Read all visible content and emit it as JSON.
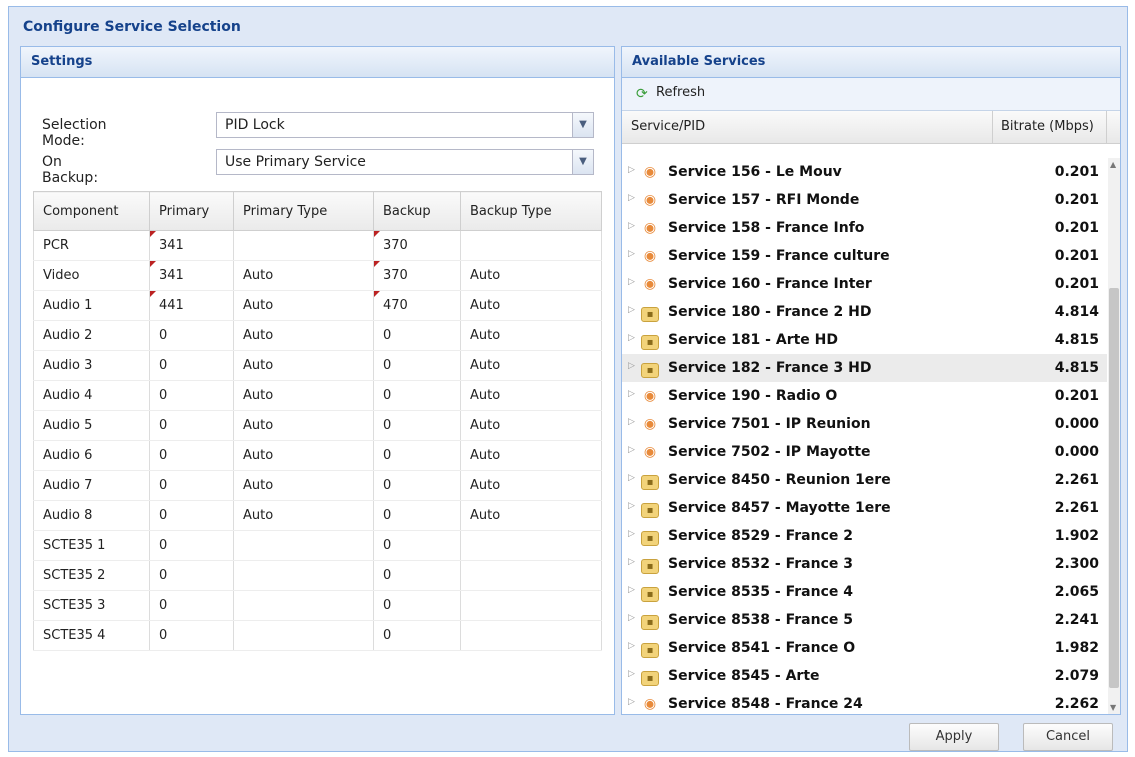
{
  "window": {
    "title": "Configure Service Selection"
  },
  "settings": {
    "title": "Settings",
    "selection_mode": {
      "label": "Selection Mode:",
      "value": "PID Lock"
    },
    "on_backup": {
      "label": "On Backup:",
      "value": "Use Primary Service"
    },
    "table": {
      "headers": [
        "Component",
        "Primary",
        "Primary Type",
        "Backup",
        "Backup Type"
      ],
      "rows": [
        [
          "PCR",
          "341",
          "",
          "370",
          ""
        ],
        [
          "Video",
          "341",
          "Auto",
          "370",
          "Auto"
        ],
        [
          "Audio 1",
          "441",
          "Auto",
          "470",
          "Auto"
        ],
        [
          "Audio 2",
          "0",
          "Auto",
          "0",
          "Auto"
        ],
        [
          "Audio 3",
          "0",
          "Auto",
          "0",
          "Auto"
        ],
        [
          "Audio 4",
          "0",
          "Auto",
          "0",
          "Auto"
        ],
        [
          "Audio 5",
          "0",
          "Auto",
          "0",
          "Auto"
        ],
        [
          "Audio 6",
          "0",
          "Auto",
          "0",
          "Auto"
        ],
        [
          "Audio 7",
          "0",
          "Auto",
          "0",
          "Auto"
        ],
        [
          "Audio 8",
          "0",
          "Auto",
          "0",
          "Auto"
        ],
        [
          "SCTE35 1",
          "0",
          "",
          "0",
          ""
        ],
        [
          "SCTE35 2",
          "0",
          "",
          "0",
          ""
        ],
        [
          "SCTE35 3",
          "0",
          "",
          "0",
          ""
        ],
        [
          "SCTE35 4",
          "0",
          "",
          "0",
          ""
        ]
      ]
    }
  },
  "services": {
    "title": "Available Services",
    "refresh_label": "Refresh",
    "col_service": "Service/PID",
    "col_bitrate": "Bitrate (Mbps)",
    "items": [
      {
        "name": "Service 156 - Le Mouv",
        "bitrate": "0.201",
        "icon": "radio"
      },
      {
        "name": "Service 157 - RFI Monde",
        "bitrate": "0.201",
        "icon": "radio"
      },
      {
        "name": "Service 158 - France Info",
        "bitrate": "0.201",
        "icon": "radio"
      },
      {
        "name": "Service 159 - France culture",
        "bitrate": "0.201",
        "icon": "radio"
      },
      {
        "name": "Service 160 - France Inter",
        "bitrate": "0.201",
        "icon": "radio"
      },
      {
        "name": "Service 180 - France 2 HD",
        "bitrate": "4.814",
        "icon": "lock"
      },
      {
        "name": "Service 181 - Arte HD",
        "bitrate": "4.815",
        "icon": "lock"
      },
      {
        "name": "Service 182 - France 3 HD",
        "bitrate": "4.815",
        "icon": "lock",
        "selected": true
      },
      {
        "name": "Service 190 - Radio O",
        "bitrate": "0.201",
        "icon": "radio"
      },
      {
        "name": "Service 7501 - IP Reunion",
        "bitrate": "0.000",
        "icon": "radio"
      },
      {
        "name": "Service 7502 - IP Mayotte",
        "bitrate": "0.000",
        "icon": "radio"
      },
      {
        "name": "Service 8450 - Reunion 1ere",
        "bitrate": "2.261",
        "icon": "lock"
      },
      {
        "name": "Service 8457 - Mayotte 1ere",
        "bitrate": "2.261",
        "icon": "lock"
      },
      {
        "name": "Service 8529 - France 2",
        "bitrate": "1.902",
        "icon": "lock"
      },
      {
        "name": "Service 8532 - France 3",
        "bitrate": "2.300",
        "icon": "lock"
      },
      {
        "name": "Service 8535 - France 4",
        "bitrate": "2.065",
        "icon": "lock"
      },
      {
        "name": "Service 8538 - France 5",
        "bitrate": "2.241",
        "icon": "lock"
      },
      {
        "name": "Service 8541 - France O",
        "bitrate": "1.982",
        "icon": "lock"
      },
      {
        "name": "Service 8545 - Arte",
        "bitrate": "2.079",
        "icon": "lock"
      },
      {
        "name": "Service 8548 - France 24",
        "bitrate": "2.262",
        "icon": "radio"
      }
    ]
  },
  "buttons": {
    "apply": "Apply",
    "cancel": "Cancel"
  }
}
